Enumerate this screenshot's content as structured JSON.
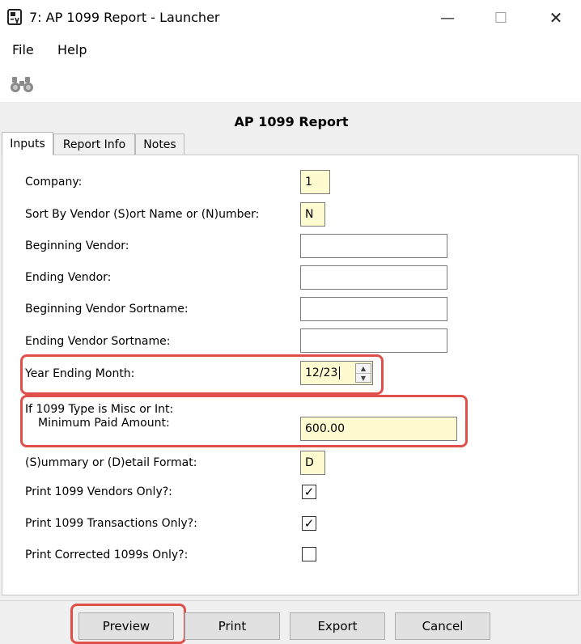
{
  "window": {
    "title": "7: AP 1099 Report - Launcher",
    "minimize_glyph": "—",
    "maximize_glyph": "☐",
    "close_glyph": "✕"
  },
  "menu": {
    "file": "File",
    "help": "Help"
  },
  "toolbar": {
    "icon": "binoculars-icon"
  },
  "report": {
    "title": "AP 1099 Report"
  },
  "tabs": [
    {
      "label": "Inputs",
      "active": true
    },
    {
      "label": "Report Info",
      "active": false
    },
    {
      "label": "Notes",
      "active": false
    }
  ],
  "fields": {
    "company": {
      "label": "Company:",
      "value": "1"
    },
    "sort_by": {
      "label": "Sort By Vendor (S)ort Name or (N)umber:",
      "value": "N"
    },
    "beginning_vendor": {
      "label": "Beginning Vendor:",
      "value": ""
    },
    "ending_vendor": {
      "label": "Ending Vendor:",
      "value": ""
    },
    "beginning_sortname": {
      "label": "Beginning Vendor Sortname:",
      "value": ""
    },
    "ending_sortname": {
      "label": "Ending Vendor Sortname:",
      "value": ""
    },
    "year_ending_month": {
      "label": "Year Ending Month:",
      "value": "12/23"
    },
    "min_paid": {
      "label_line1": "If 1099 Type is Misc or Int:",
      "label_line2": "Minimum Paid Amount:",
      "value": "600.00"
    },
    "format": {
      "label": "(S)ummary or (D)etail Format:",
      "value": "D"
    },
    "print_1099_vendors": {
      "label": "Print 1099 Vendors Only?:",
      "checked": true,
      "glyph": "✓"
    },
    "print_1099_transactions": {
      "label": "Print 1099 Transactions Only?:",
      "checked": true,
      "glyph": "✓"
    },
    "print_corrected": {
      "label": "Print Corrected 1099s Only?:",
      "checked": false,
      "glyph": ""
    }
  },
  "buttons": {
    "preview": "Preview",
    "print": "Print",
    "export": "Export",
    "cancel": "Cancel"
  },
  "colors": {
    "highlight": "#e0504a",
    "input_yellow": "#fdfbcf",
    "panel_bg": "#f0f0f0"
  }
}
